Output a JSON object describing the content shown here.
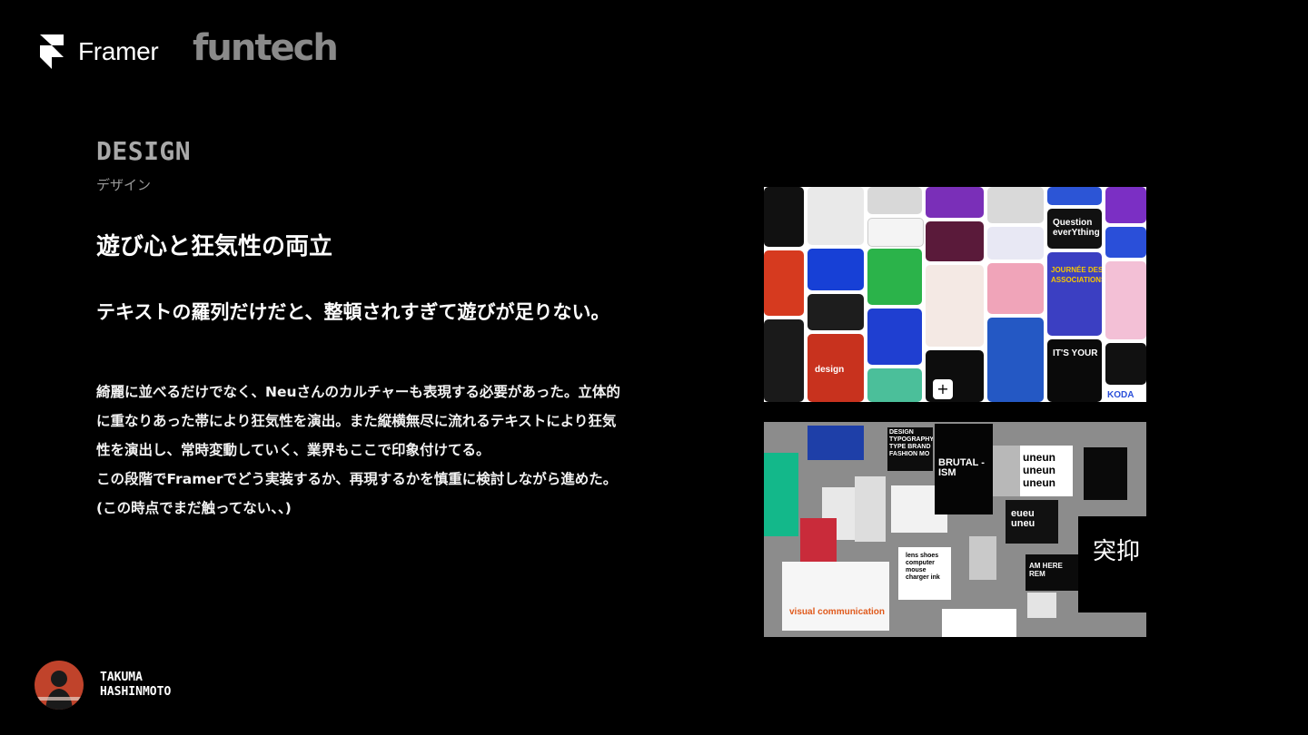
{
  "brand": {
    "primary": "Framer",
    "partner": "funtech"
  },
  "section": {
    "title": "DESIGN",
    "subtitle": "デザイン"
  },
  "headline": "遊び心と狂気性の両立",
  "lead": "テキストの羅列だけだと、整頓されすぎて遊びが足りない。",
  "body": {
    "paragraph1": "綺麗に並べるだけでなく、Neuさんのカルチャーも表現する必要があった。立体的に重なりあった帯により狂気性を演出。また縦横無尽に流れるテキストにより狂気性を演出し、常時変動していく、業界もここで印象付けてる。",
    "paragraph2": "この段階でFramerでどう実装するか、再現するかを慎重に検討しながら進めた。(この時点でまだ触ってない、、)"
  },
  "collage_top": {
    "icon": "moodboard-grid",
    "tile_texts": [
      "Question everYthing",
      "design",
      "JOURNÉE DES ASSOCIATIONS",
      "IT'S YOUR",
      "KODA"
    ],
    "add_button": "+"
  },
  "collage_bottom": {
    "icon": "moodboard-scatter",
    "tile_texts": [
      "DESIGN TYPOGRAPHY TYPE BRAND FASHION MO",
      "BRUTAL - ISM",
      "uneun uneun uneun",
      "eueu uneu",
      "lens shoes computer mouse charger ink",
      "AM HERE REM",
      "突抑",
      "visual communication"
    ]
  },
  "author": {
    "first": "TAKUMA",
    "last": "HASHINMOTO"
  },
  "colors": {
    "background": "#000000",
    "text": "#ffffff",
    "muted": "#a9a9a9",
    "avatar": "#c0432b"
  }
}
